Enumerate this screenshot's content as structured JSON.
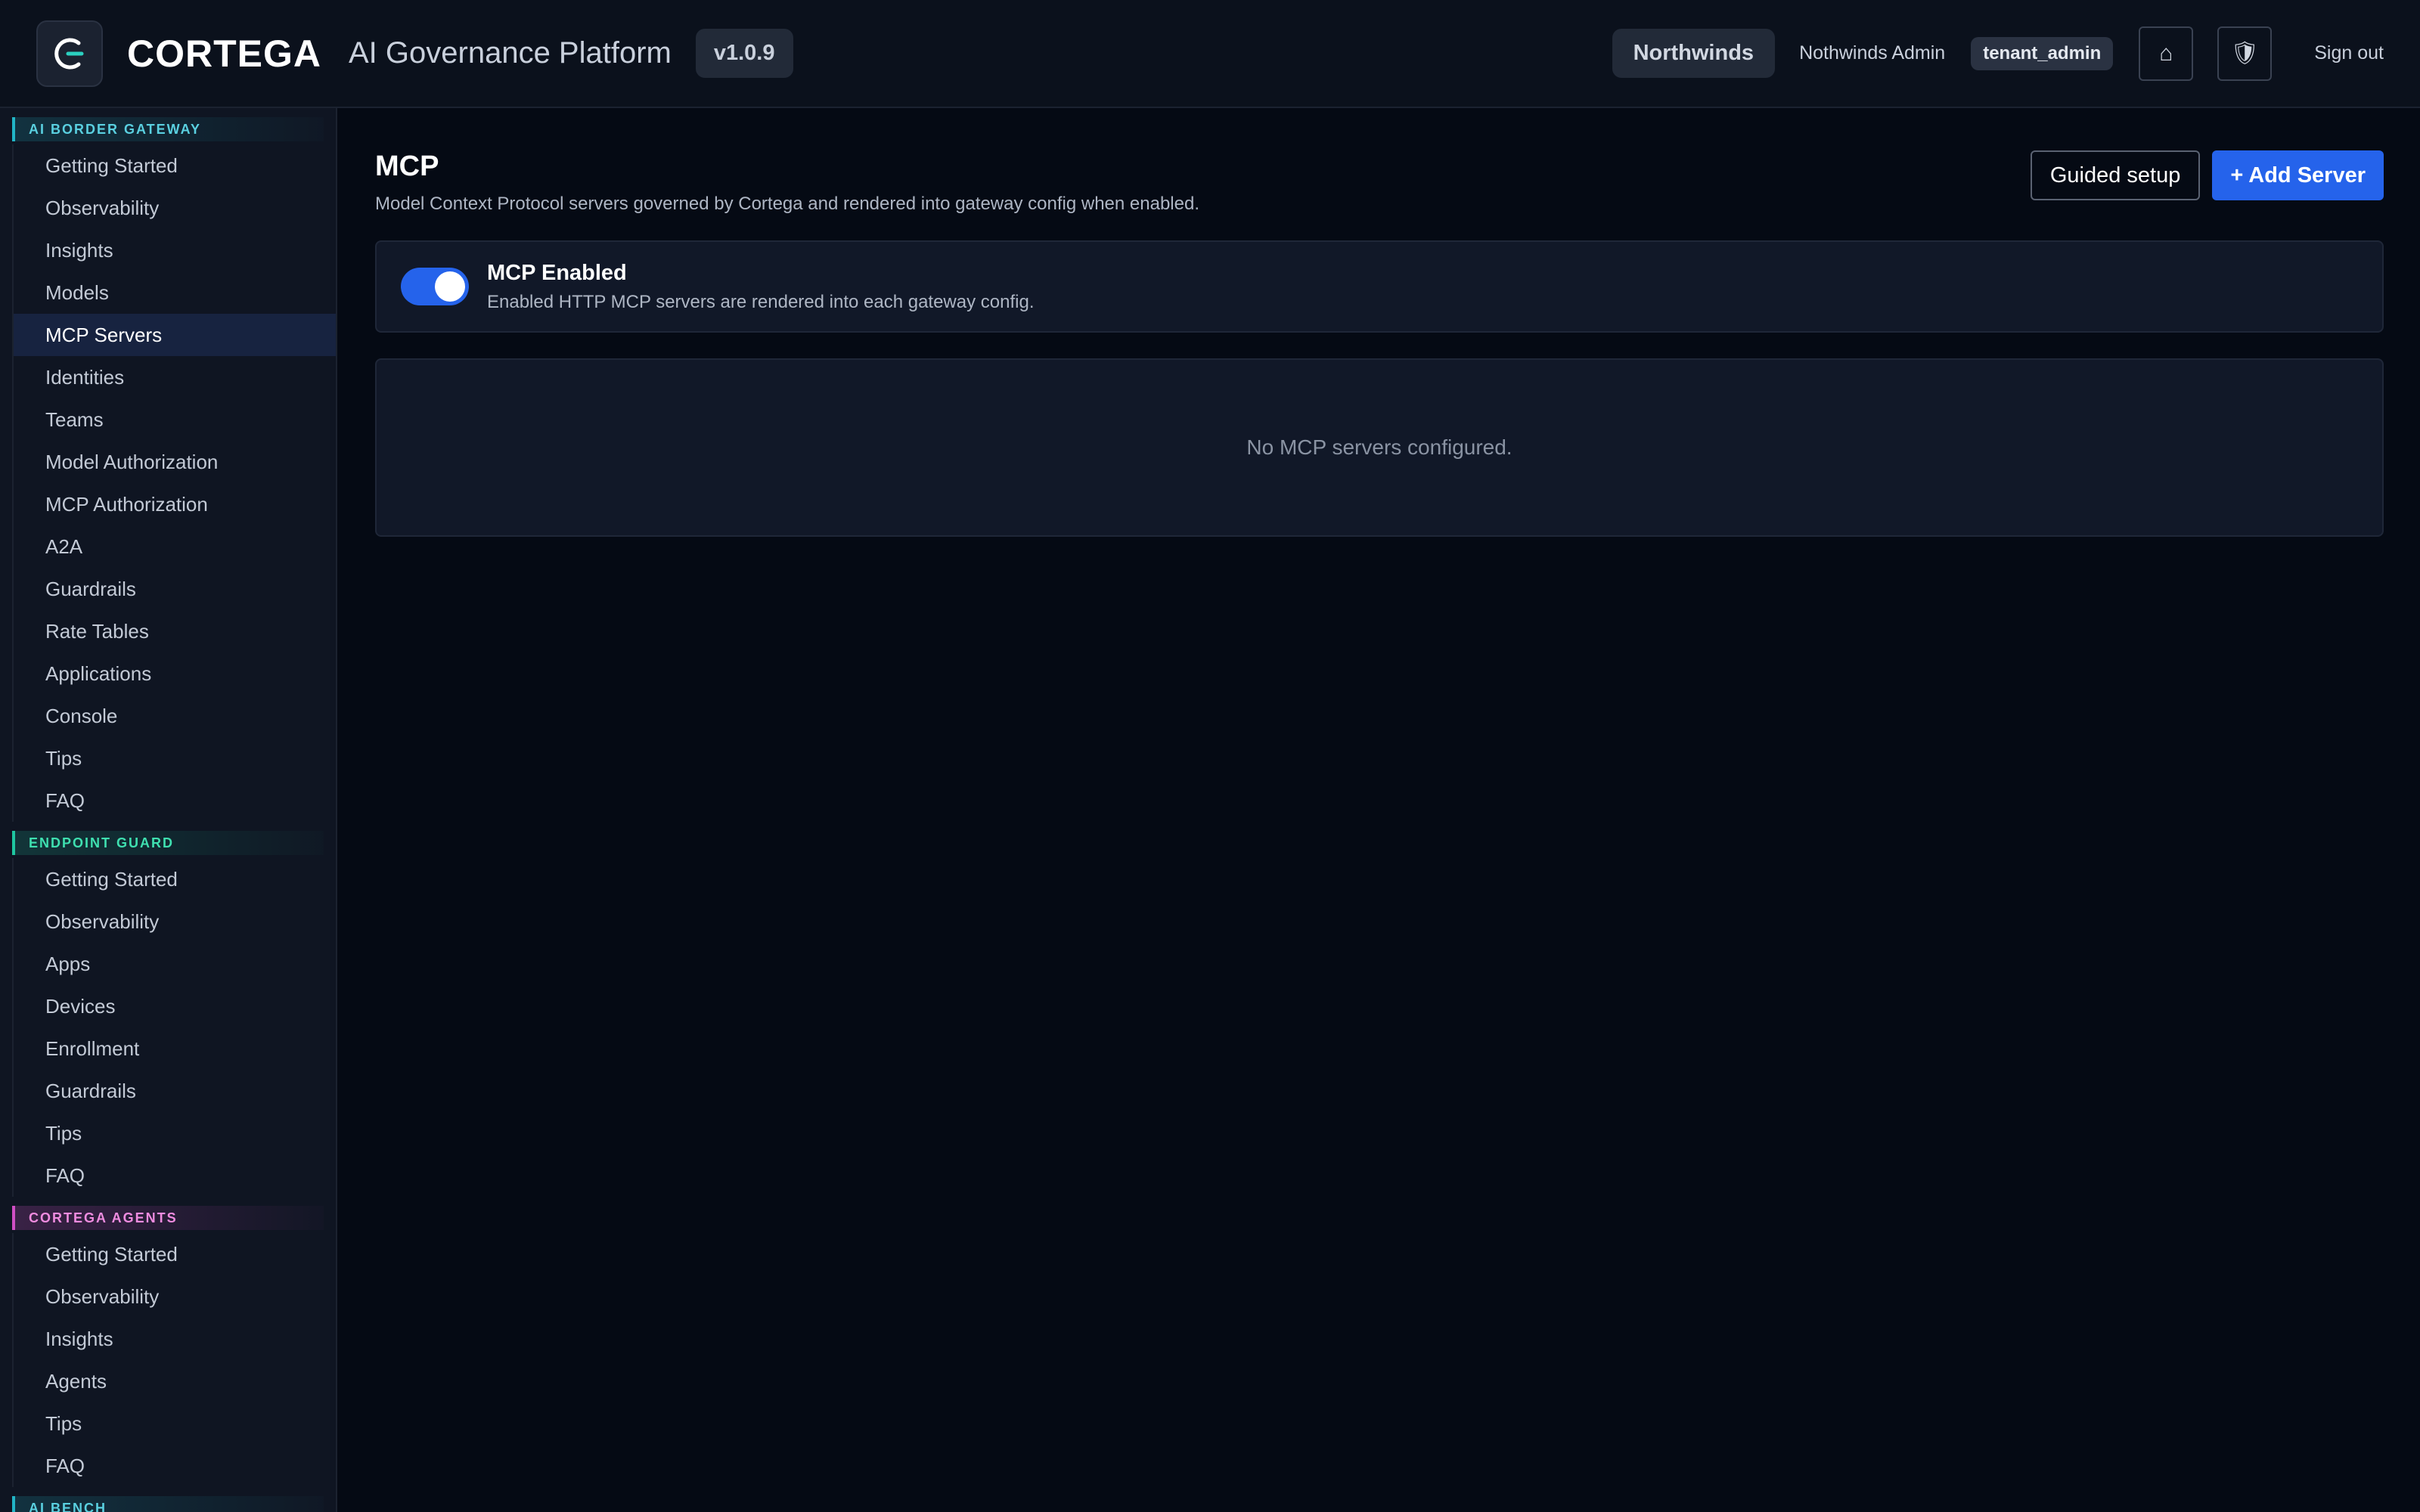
{
  "header": {
    "brand": "CORTEGA",
    "platform": "AI Governance Platform",
    "version": "v1.0.9",
    "tenant": "Northwinds",
    "user": "Nothwinds Admin",
    "role": "tenant_admin",
    "home_icon": "⌂",
    "shield_icon": "🛡",
    "signout": "Sign out"
  },
  "sidebar": {
    "sections": [
      {
        "title": "AI BORDER GATEWAY",
        "items": [
          "Getting Started",
          "Observability",
          "Insights",
          "Models",
          "MCP Servers",
          "Identities",
          "Teams",
          "Model Authorization",
          "MCP Authorization",
          "A2A",
          "Guardrails",
          "Rate Tables",
          "Applications",
          "Console",
          "Tips",
          "FAQ"
        ]
      },
      {
        "title": "ENDPOINT GUARD",
        "items": [
          "Getting Started",
          "Observability",
          "Apps",
          "Devices",
          "Enrollment",
          "Guardrails",
          "Tips",
          "FAQ"
        ]
      },
      {
        "title": "CORTEGA AGENTS",
        "items": [
          "Getting Started",
          "Observability",
          "Insights",
          "Agents",
          "Tips",
          "FAQ"
        ]
      },
      {
        "title": "AI BENCH",
        "items": []
      }
    ],
    "active": "MCP Servers"
  },
  "main": {
    "title": "MCP",
    "subtitle": "Model Context Protocol servers governed by Cortega and rendered into gateway config when enabled.",
    "guided_setup": "Guided setup",
    "add_server": "+ Add Server",
    "toggle_title": "MCP Enabled",
    "toggle_desc": "Enabled HTTP MCP servers are rendered into each gateway config.",
    "toggle_on": true,
    "empty_text": "No MCP servers configured."
  },
  "colors": {
    "accent": "#2563eb",
    "background": "#050a14"
  }
}
